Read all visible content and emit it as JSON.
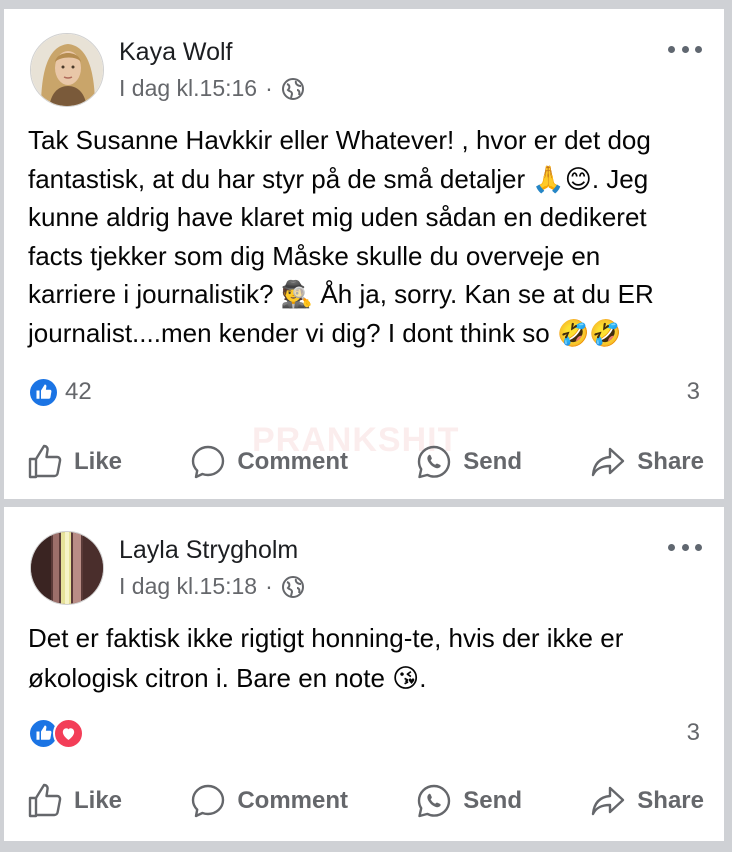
{
  "posts": [
    {
      "author": "Kaya Wolf",
      "timestamp": "I dag kl.15:16",
      "separator": "·",
      "privacy_icon": "globe-icon",
      "text_lines": [
        "Tak Susanne Havkkir eller Whatever! , hvor er det dog",
        "fantastisk, at du har styr på de små detaljer 🙏😊. Jeg",
        "kunne aldrig have klaret mig uden sådan en dedikeret",
        "facts tjekker som dig Måske skulle du overveje en",
        "karriere i journalistik? 🕵️ Åh ja, sorry. Kan se at du ER",
        "journalist....men kender vi dig? I dont think so 🤣🤣"
      ],
      "reactions": [
        "like"
      ],
      "reaction_count": "42",
      "comment_count": "3"
    },
    {
      "author": "Layla Strygholm",
      "timestamp": "I dag kl.15:18",
      "separator": "·",
      "privacy_icon": "globe-icon",
      "text_lines": [
        "Det er faktisk ikke rigtigt honning-te, hvis der ikke er",
        "økologisk citron i. Bare en note 😘."
      ],
      "reactions": [
        "like",
        "love"
      ],
      "reaction_count": "",
      "comment_count": "3"
    }
  ],
  "actions": {
    "like": "Like",
    "comment": "Comment",
    "send": "Send",
    "share": "Share"
  },
  "watermark": "PRANKSHIT",
  "colors": {
    "background": "#cfd1d5",
    "card": "#ffffff",
    "like_blue": "#1b74e4",
    "love_red": "#f33e58",
    "secondary_text": "#65676b"
  }
}
